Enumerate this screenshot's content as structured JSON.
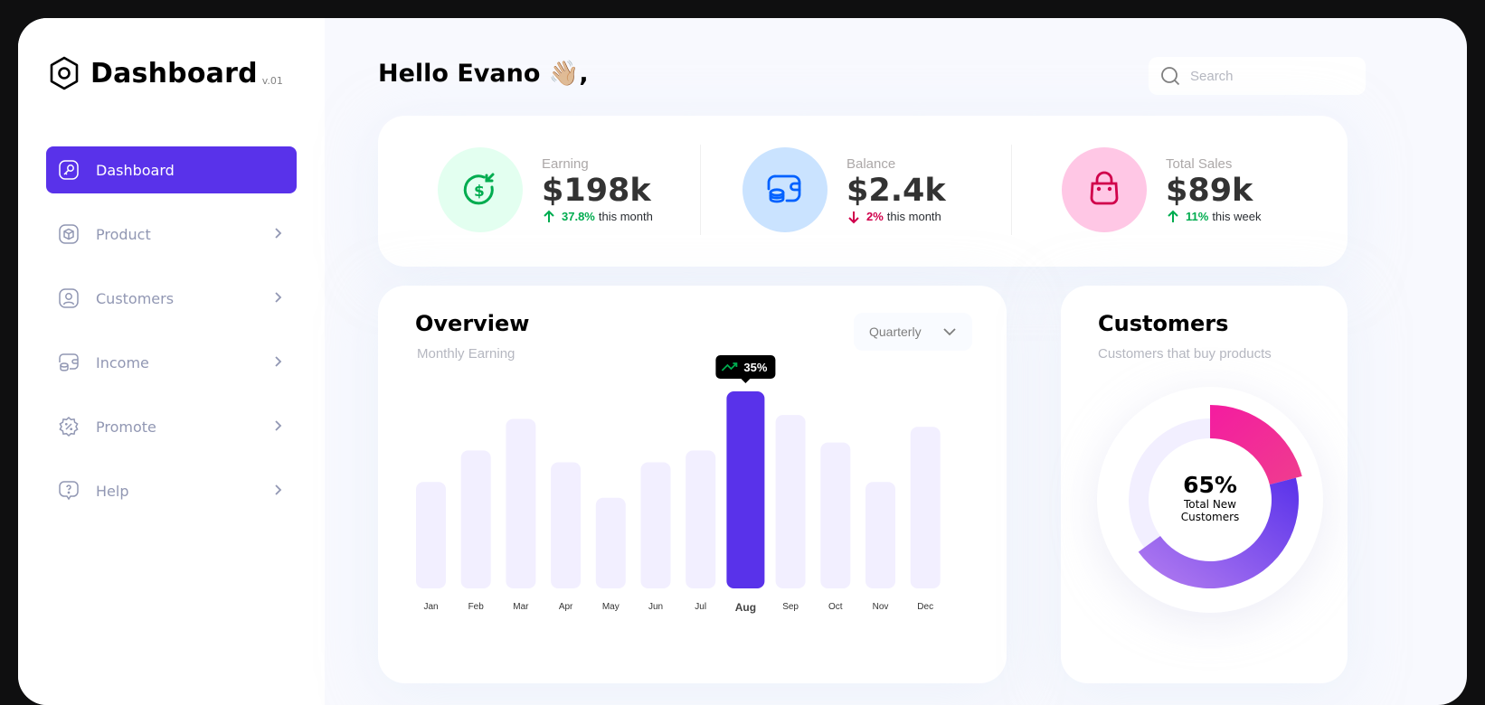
{
  "app": {
    "title": "Dashboard",
    "version": "v.01"
  },
  "sidebar": {
    "items": [
      {
        "label": "Dashboard",
        "icon": "key-square-icon",
        "active": true
      },
      {
        "label": "Product",
        "icon": "cube-icon"
      },
      {
        "label": "Customers",
        "icon": "user-square-icon"
      },
      {
        "label": "Income",
        "icon": "wallet-money-icon"
      },
      {
        "label": "Promote",
        "icon": "discount-shape-icon"
      },
      {
        "label": "Help",
        "icon": "message-question-icon"
      }
    ]
  },
  "header": {
    "greeting": "Hello Evano 👋🏼,",
    "search_placeholder": "Search"
  },
  "stats": [
    {
      "label": "Earning",
      "value": "$198k",
      "pct": "37.8%",
      "period": "this month",
      "direction": "up",
      "icon": "dollar-circle-icon",
      "color": "#00ac4f",
      "bg": "#e3fff0"
    },
    {
      "label": "Balance",
      "value": "$2.4k",
      "pct": "2%",
      "period": "this month",
      "direction": "down",
      "icon": "wallet-icon",
      "color": "#d0004b",
      "bg": "#cae3ff"
    },
    {
      "label": "Total Sales",
      "value": "$89k",
      "pct": "11%",
      "period": "this week",
      "direction": "up",
      "icon": "shopping-bag-icon",
      "color": "#00ac4f",
      "bg": "#ffc7e5"
    }
  ],
  "overview": {
    "title": "Overview",
    "subtitle": "Monthly Earning",
    "period_select": "Quarterly"
  },
  "chart_data": {
    "type": "bar",
    "categories": [
      "Jan",
      "Feb",
      "Mar",
      "Apr",
      "May",
      "Jun",
      "Jul",
      "Aug",
      "Sep",
      "Oct",
      "Nov",
      "Dec"
    ],
    "values": [
      54,
      70,
      86,
      64,
      46,
      64,
      70,
      100,
      88,
      74,
      54,
      82
    ],
    "highlight": "Aug",
    "highlight_label": "35%",
    "bar_color": "#f2efff",
    "highlight_color": "#5932ea",
    "ylim": [
      0,
      100
    ]
  },
  "customers": {
    "title": "Customers",
    "subtitle": "Customers that buy products",
    "percent": "65%",
    "caption_line1": "Total New",
    "caption_line2": "Customers",
    "chart_data": {
      "type": "pie",
      "segments": [
        {
          "value": 21,
          "color": "#f41ca0"
        },
        {
          "value": 44,
          "color": "#5932ea"
        },
        {
          "value": 35,
          "color": "#f2efff"
        }
      ]
    }
  },
  "colors": {
    "accent": "#5932ea",
    "muted": "#9197b3",
    "up": "#00ac4f",
    "down": "#d0004b"
  }
}
